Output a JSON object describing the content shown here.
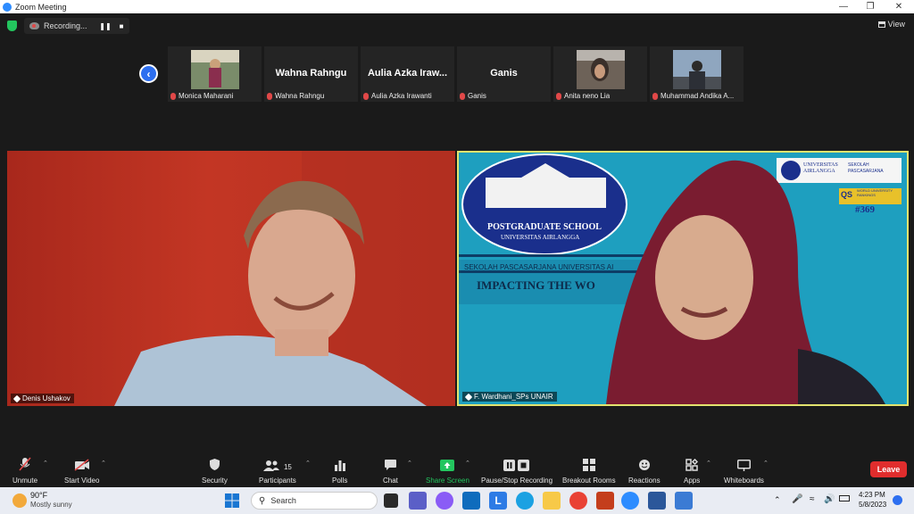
{
  "window": {
    "title": "Zoom Meeting"
  },
  "recording": {
    "label": "Recording..."
  },
  "view_label": "View",
  "participants_strip": [
    {
      "name": "Monica Maharani",
      "has_video": true
    },
    {
      "name": "Wahna Rahngu",
      "display": "Wahna Rahngu",
      "has_video": false
    },
    {
      "name": "Aulia Azka Irawanti",
      "display": "Aulia Azka Iraw...",
      "has_video": false
    },
    {
      "name": "Ganis",
      "display": "Ganis",
      "has_video": false
    },
    {
      "name": "Anita neno Lia",
      "has_video": true
    },
    {
      "name": "Muhammad Andika A...",
      "has_video": true
    }
  ],
  "main_videos": [
    {
      "name": "Denis Ushakov"
    },
    {
      "name": "F. Wardhani_SPs UNAIR"
    }
  ],
  "slide": {
    "banner_line1": "POSTGRADUATE SCHOOL",
    "banner_line2": "UNIVERSITAS AIRLANGGA",
    "tagline": "SEKOLAH PASCASARJANA UNIVERSITAS AI",
    "headline": "IMPACTING THE WO",
    "logo_text1": "UNIVERSITAS AIRLANGGA",
    "logo_text2": "SEKOLAH PASCASARJANA",
    "qs_label": "QS",
    "qs_sub": "WORLD UNIVERSITY RANKINGS",
    "rank": "#369"
  },
  "toolbar": {
    "unmute": "Unmute",
    "start_video": "Start Video",
    "security": "Security",
    "participants": "Participants",
    "participants_count": "15",
    "polls": "Polls",
    "chat": "Chat",
    "share_screen": "Share Screen",
    "pause_stop": "Pause/Stop Recording",
    "breakout": "Breakout Rooms",
    "reactions": "Reactions",
    "apps": "Apps",
    "whiteboards": "Whiteboards",
    "leave": "Leave"
  },
  "colors": {
    "share_green": "#23c55e",
    "leave_red": "#e02d2d",
    "active_border": "#e3e36e",
    "zoom_blue": "#2d8cff"
  },
  "taskbar": {
    "weather_temp": "90°F",
    "weather_desc": "Mostly sunny",
    "search_placeholder": "Search",
    "time": "4:23 PM",
    "date": "5/8/2023"
  }
}
